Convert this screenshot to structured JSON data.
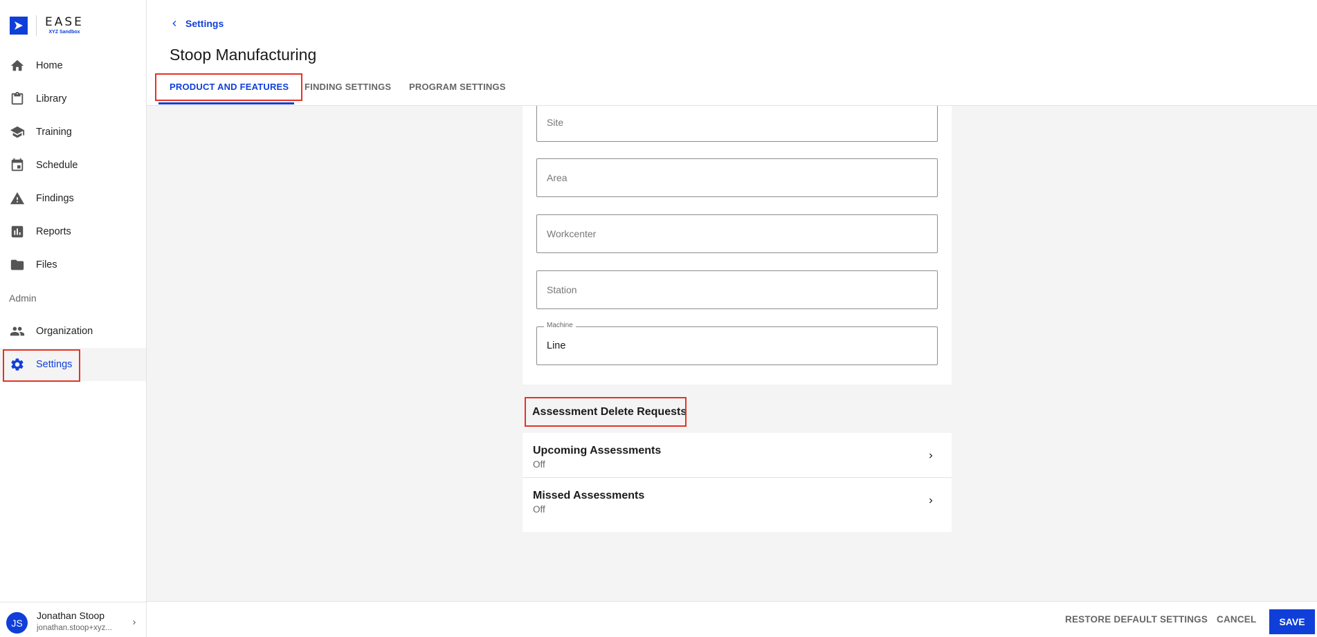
{
  "brand": {
    "name": "EASE",
    "subtitle": "XYZ Sandbox"
  },
  "sidebar": {
    "items": [
      {
        "label": "Home",
        "icon": "home-icon"
      },
      {
        "label": "Library",
        "icon": "clipboard-icon"
      },
      {
        "label": "Training",
        "icon": "graduation-cap-icon"
      },
      {
        "label": "Schedule",
        "icon": "calendar-icon"
      },
      {
        "label": "Findings",
        "icon": "warning-icon"
      },
      {
        "label": "Reports",
        "icon": "bar-chart-icon"
      },
      {
        "label": "Files",
        "icon": "folder-icon"
      }
    ],
    "admin_label": "Admin",
    "admin_items": [
      {
        "label": "Organization",
        "icon": "people-icon"
      },
      {
        "label": "Settings",
        "icon": "gear-icon",
        "active": true
      }
    ]
  },
  "user": {
    "initials": "JS",
    "name": "Jonathan Stoop",
    "email": "jonathan.stoop+xyz..."
  },
  "header": {
    "back_label": "Settings",
    "title": "Stoop Manufacturing",
    "tabs": [
      {
        "label": "PRODUCT AND FEATURES",
        "active": true
      },
      {
        "label": "FINDING SETTINGS"
      },
      {
        "label": "PROGRAM SETTINGS"
      }
    ]
  },
  "hierarchy_fields": [
    {
      "placeholder": "Site"
    },
    {
      "placeholder": "Area"
    },
    {
      "placeholder": "Workcenter"
    },
    {
      "placeholder": "Station"
    },
    {
      "label": "Machine",
      "value": "Line"
    }
  ],
  "delete_requests": {
    "title": "Assessment Delete Requests",
    "items": [
      {
        "title": "Upcoming Assessments",
        "status": "Off"
      },
      {
        "title": "Missed Assessments",
        "status": "Off"
      }
    ]
  },
  "footer": {
    "restore_label": "RESTORE DEFAULT SETTINGS",
    "cancel_label": "CANCEL",
    "save_label": "SAVE"
  },
  "colors": {
    "accent": "#0f3fd8",
    "highlight": "#e53224",
    "background": "#f4f4f4"
  }
}
